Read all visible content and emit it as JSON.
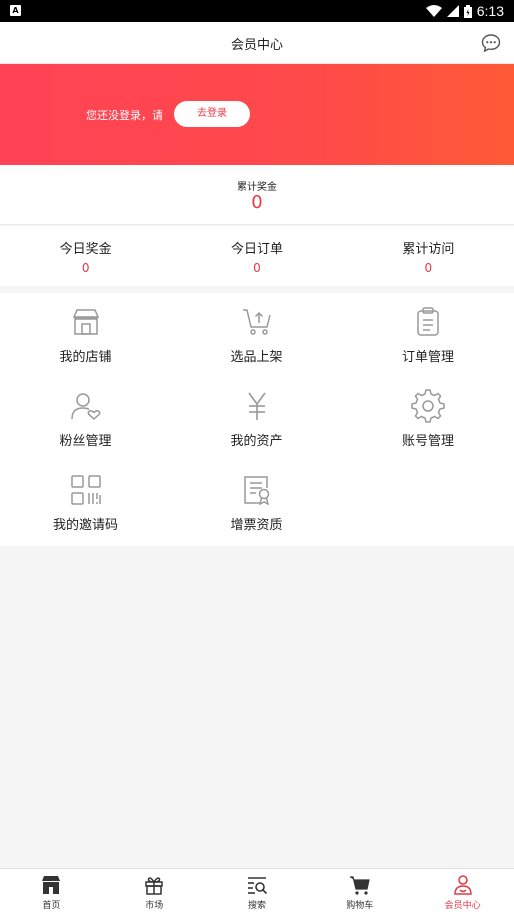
{
  "status_bar": {
    "time": "6:13",
    "app_badge": "A"
  },
  "header": {
    "title": "会员中心"
  },
  "banner": {
    "hint": "您还没登录，请",
    "login_button": "去登录"
  },
  "total": {
    "label": "累计奖金",
    "value": "0"
  },
  "stats": [
    {
      "label": "今日奖金",
      "value": "0"
    },
    {
      "label": "今日订单",
      "value": "0"
    },
    {
      "label": "累计访问",
      "value": "0"
    }
  ],
  "menu": [
    {
      "label": "我的店铺",
      "icon": "store-icon"
    },
    {
      "label": "选品上架",
      "icon": "cart-upload-icon"
    },
    {
      "label": "订单管理",
      "icon": "clipboard-icon"
    },
    {
      "label": "粉丝管理",
      "icon": "fan-user-icon"
    },
    {
      "label": "我的资产",
      "icon": "yen-icon"
    },
    {
      "label": "账号管理",
      "icon": "gear-icon"
    },
    {
      "label": "我的邀请码",
      "icon": "qr-code-icon"
    },
    {
      "label": "增票资质",
      "icon": "certificate-icon"
    }
  ],
  "tabbar": [
    {
      "label": "首页",
      "icon": "home-store-icon"
    },
    {
      "label": "市场",
      "icon": "gift-icon"
    },
    {
      "label": "搜索",
      "icon": "search-list-icon"
    },
    {
      "label": "购物车",
      "icon": "cart-icon"
    },
    {
      "label": "会员中心",
      "icon": "member-icon",
      "active": true
    }
  ],
  "colors": {
    "accent": "#e53945",
    "banner_start": "#ff4256",
    "banner_end": "#ff5a36",
    "icon_gray": "#999999"
  }
}
